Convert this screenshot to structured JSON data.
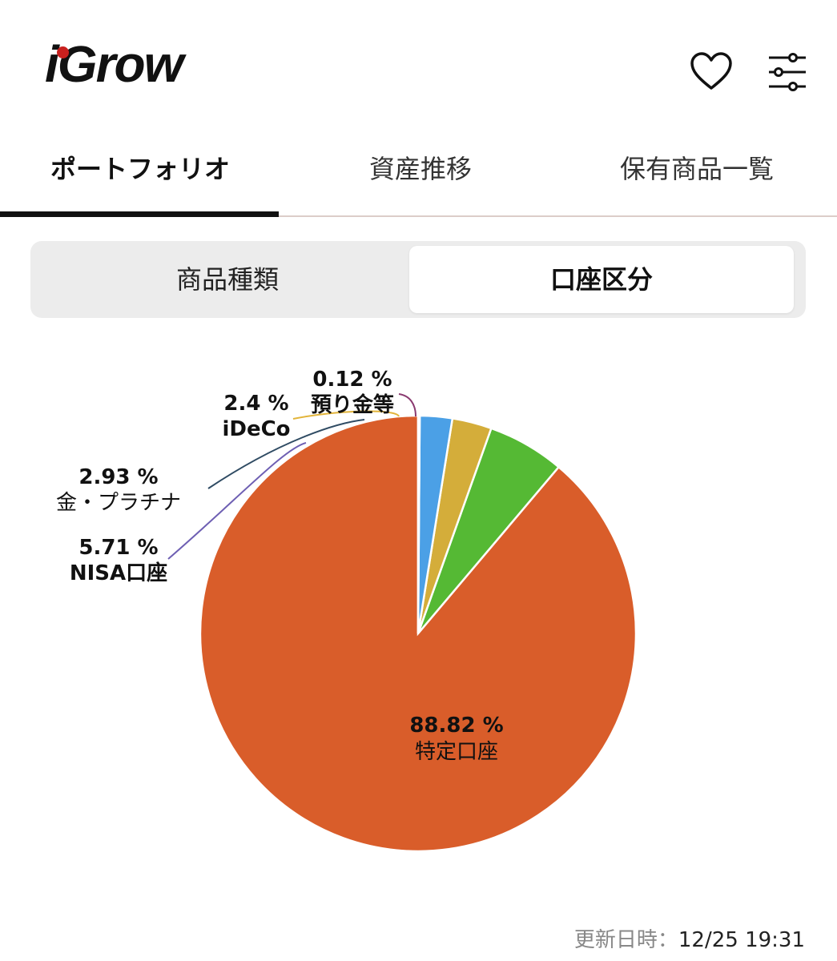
{
  "app": {
    "logo_text": "iGrow"
  },
  "icons": {
    "heart": "heart-icon",
    "settings": "sliders-icon"
  },
  "tabs": [
    {
      "label": "ポートフォリオ",
      "active": true
    },
    {
      "label": "資産推移",
      "active": false
    },
    {
      "label": "保有商品一覧",
      "active": false
    }
  ],
  "segments": [
    {
      "label": "商品種類",
      "active": false
    },
    {
      "label": "口座区分",
      "active": true
    }
  ],
  "chart_data": {
    "type": "pie",
    "slices": [
      {
        "name": "特定口座",
        "percent_label": "88.82 %",
        "value": 88.82,
        "color": "#d95d2a"
      },
      {
        "name": "NISA口座",
        "percent_label": "5.71 %",
        "value": 5.71,
        "color": "#55b934"
      },
      {
        "name": "金・プラチナ",
        "percent_label": "2.93 %",
        "value": 2.93,
        "color": "#d4ad3a"
      },
      {
        "name": "iDeCo",
        "percent_label": "2.4 %",
        "value": 2.4,
        "color": "#4ba0e6"
      },
      {
        "name": "預り金等",
        "percent_label": "0.12 %",
        "value": 0.12,
        "color": "#8a3a70"
      }
    ],
    "leader_colors": [
      "#6e5fb3",
      "#2f4b63",
      "#e2b43a",
      "#8a3a70"
    ]
  },
  "footer": {
    "updated_key": "更新日時：",
    "updated_value": "12/25 19:31"
  }
}
